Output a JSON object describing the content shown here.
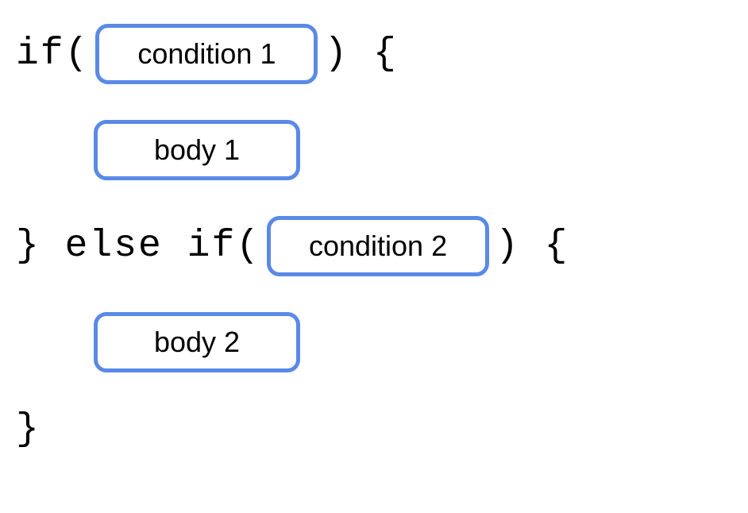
{
  "line1": {
    "pre": "if(",
    "box": "condition 1",
    "post": ") {"
  },
  "line2": {
    "box": "body 1"
  },
  "line3": {
    "pre": "} else if(",
    "box": "condition 2",
    "post": ") {"
  },
  "line4": {
    "box": "body 2"
  },
  "line5": {
    "text": "}"
  }
}
